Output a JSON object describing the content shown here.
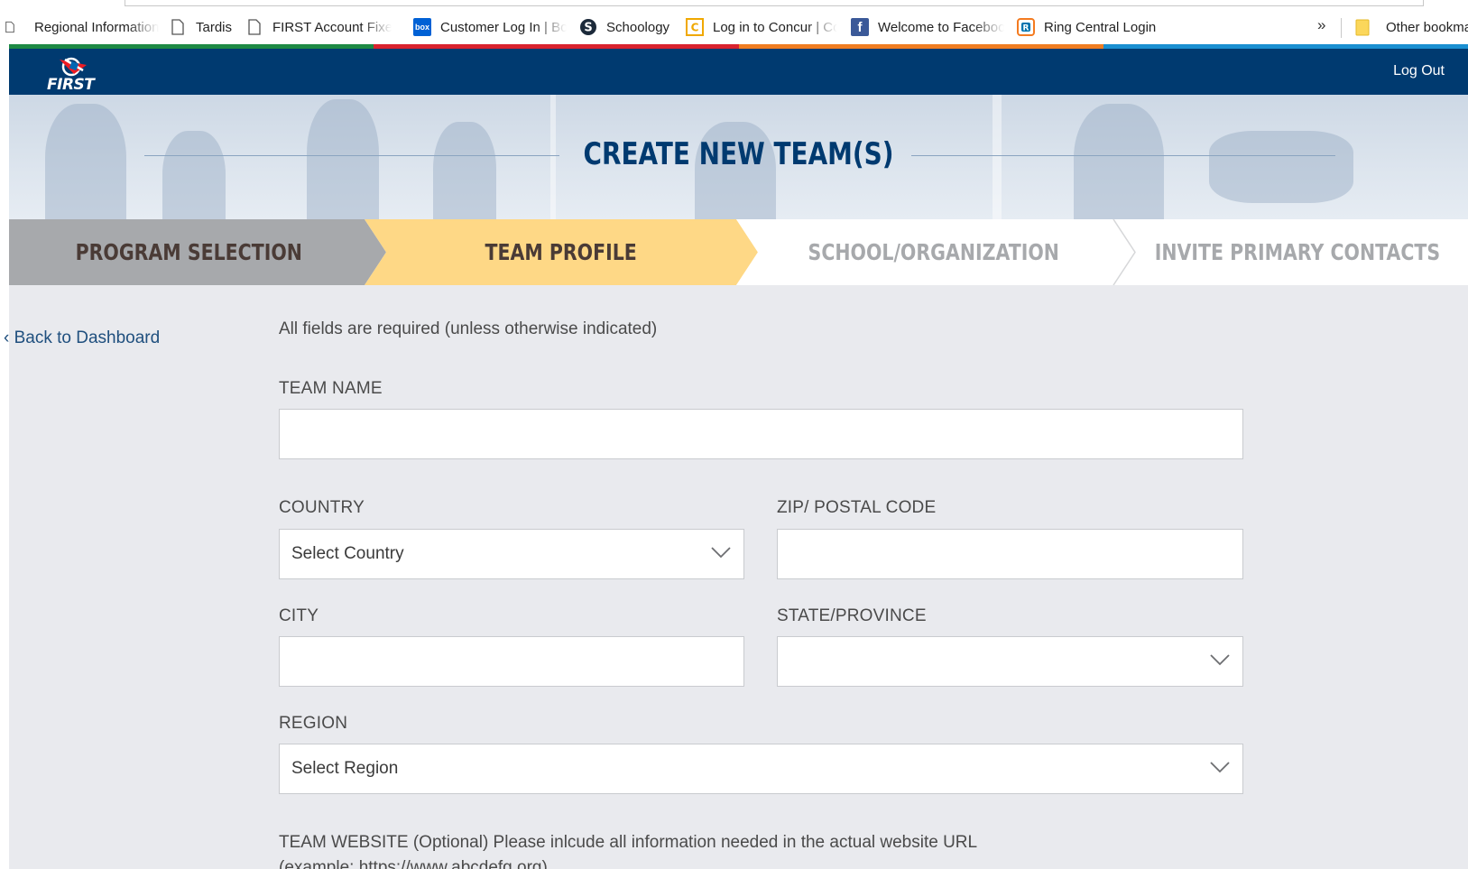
{
  "bookmarks": {
    "items": [
      {
        "label": "Regional Information",
        "icon": "page-icon"
      },
      {
        "label": "Tardis",
        "icon": "page-icon"
      },
      {
        "label": "FIRST Account Fixer",
        "icon": "page-icon"
      },
      {
        "label": "Customer Log In | Box",
        "icon": "box-icon"
      },
      {
        "label": "Schoology",
        "icon": "schoology-icon"
      },
      {
        "label": "Log in to Concur | Concur",
        "icon": "concur-icon"
      },
      {
        "label": "Welcome to Facebook",
        "icon": "facebook-icon"
      },
      {
        "label": "Ring Central Login",
        "icon": "ringcentral-icon"
      }
    ],
    "more": "»",
    "other": "Other bookmarks"
  },
  "stripe_colors": [
    "#1e8a44",
    "#d9232e",
    "#ef7d22",
    "#1a8fd1"
  ],
  "navbar": {
    "brand": "FIRST",
    "logout": "Log Out",
    "bg": "#003a70"
  },
  "hero": {
    "title": "CREATE NEW TEAM(S)"
  },
  "steps": [
    {
      "label": "PROGRAM SELECTION",
      "state": "completed",
      "bg": "#a7a9ac",
      "color": "#4a3b36"
    },
    {
      "label": "TEAM PROFILE",
      "state": "active",
      "bg": "#fed886",
      "color": "#4a3b36"
    },
    {
      "label": "SCHOOL/ORGANIZATION",
      "state": "upcoming",
      "bg": "#ffffff",
      "color": "#a7a9ac"
    },
    {
      "label": "INVITE PRIMARY CONTACTS",
      "state": "upcoming",
      "bg": "#ffffff",
      "color": "#a7a9ac"
    }
  ],
  "sidebar": {
    "back_link": "‹ Back to Dashboard"
  },
  "form": {
    "required_note": "All fields are required (unless otherwise indicated)",
    "team_name": {
      "label": "TEAM NAME",
      "value": ""
    },
    "country": {
      "label": "COUNTRY",
      "value": "Select Country"
    },
    "zip": {
      "label": "ZIP/ POSTAL CODE",
      "value": ""
    },
    "city": {
      "label": "CITY",
      "value": ""
    },
    "state": {
      "label": "STATE/PROVINCE",
      "value": ""
    },
    "region": {
      "label": "REGION",
      "value": "Select Region"
    },
    "website_help": {
      "line1": "TEAM WEBSITE (Optional) Please inlcude all information needed in the actual website URL",
      "line2": "(example: https://www.abcdefg.org)"
    }
  }
}
